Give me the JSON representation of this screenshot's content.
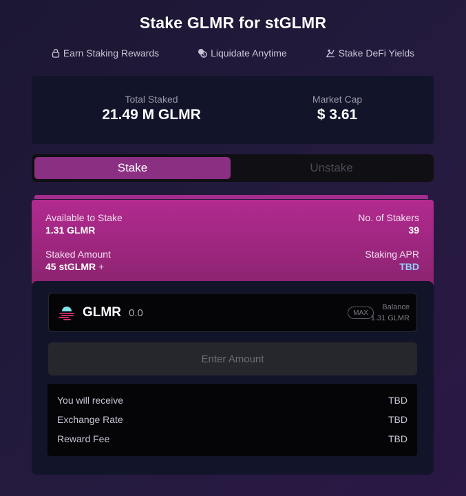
{
  "title": "Stake GLMR for stGLMR",
  "features": [
    {
      "icon": "lock-icon",
      "label": "Earn Staking Rewards"
    },
    {
      "icon": "coins-icon",
      "label": "Liquidate Anytime"
    },
    {
      "icon": "farm-icon",
      "label": "Stake DeFi Yields"
    }
  ],
  "stats": {
    "total_staked_label": "Total Staked",
    "total_staked_value": "21.49 M GLMR",
    "market_cap_label": "Market Cap",
    "market_cap_value": "$ 3.61"
  },
  "tabs": {
    "stake": "Stake",
    "unstake": "Unstake",
    "active": "stake"
  },
  "info": {
    "available_label": "Available to Stake",
    "available_value": "1.31 GLMR",
    "stakers_label": "No. of Stakers",
    "stakers_value": "39",
    "staked_label": "Staked Amount",
    "staked_value": "45 stGLMR",
    "plus": "+",
    "apr_label": "Staking APR",
    "apr_value": "TBD"
  },
  "input": {
    "token": "GLMR",
    "amount": "0.0",
    "max_label": "MAX",
    "balance_label": "Balance",
    "balance_value": "1.31 GLMR"
  },
  "enter_amount": "Enter Amount",
  "summary": [
    {
      "label": "You will receive",
      "value": "TBD"
    },
    {
      "label": "Exchange Rate",
      "value": "TBD"
    },
    {
      "label": "Reward Fee",
      "value": "TBD"
    }
  ],
  "colors": {
    "accent": "#b22a8f",
    "tab_active": "#8a2f82",
    "apr_highlight": "#8fd6ff",
    "token_cyan": "#7ee4e8",
    "token_pink": "#e5347a"
  }
}
